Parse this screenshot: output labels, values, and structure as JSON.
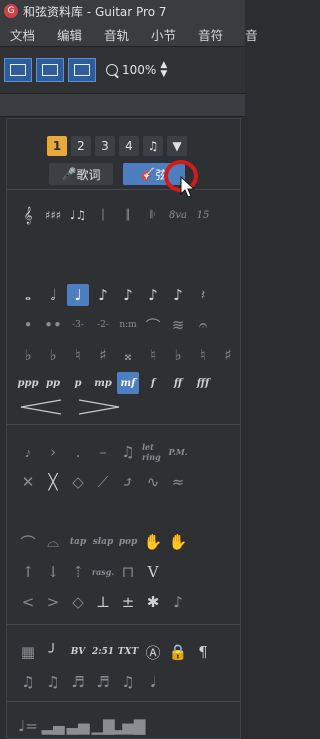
{
  "window": {
    "title": "和弦资料库 - Guitar Pro 7"
  },
  "menu": [
    "文档",
    "编辑",
    "音轨",
    "小节",
    "音符",
    "音"
  ],
  "toolbar": {
    "zoom": "100%"
  },
  "voices": [
    "1",
    "2",
    "3",
    "4"
  ],
  "active_voice": "1",
  "lyrics_label": "歌词",
  "fret_label": "弦",
  "dynamics": [
    "ppp",
    "pp",
    "p",
    "mp",
    "mf",
    "f",
    "ff",
    "fff"
  ],
  "active_dynamic": "mf",
  "note_values": [
    "𝅝",
    "𝅗𝅥",
    "♩",
    "♪",
    "♪",
    "♪",
    "♪"
  ],
  "row_clefs": [
    "𝄞",
    "♯♯♯",
    "♩♫",
    "𝄀",
    "𝄁"
  ],
  "row_accidentals": [
    "♭",
    "♭",
    "♮",
    "♯",
    "𝄪",
    "♮",
    "♭",
    "♮",
    "♯",
    "♯"
  ],
  "misc_labels": [
    "let ring",
    "P.M.",
    "tap",
    "slap",
    "pop",
    "rasg.",
    "BV",
    "2:51",
    "TXT"
  ],
  "colors": {
    "accent": "#4d7fc0",
    "voice_active": "#e6a93a",
    "highlight_circle": "#d51a1a"
  }
}
